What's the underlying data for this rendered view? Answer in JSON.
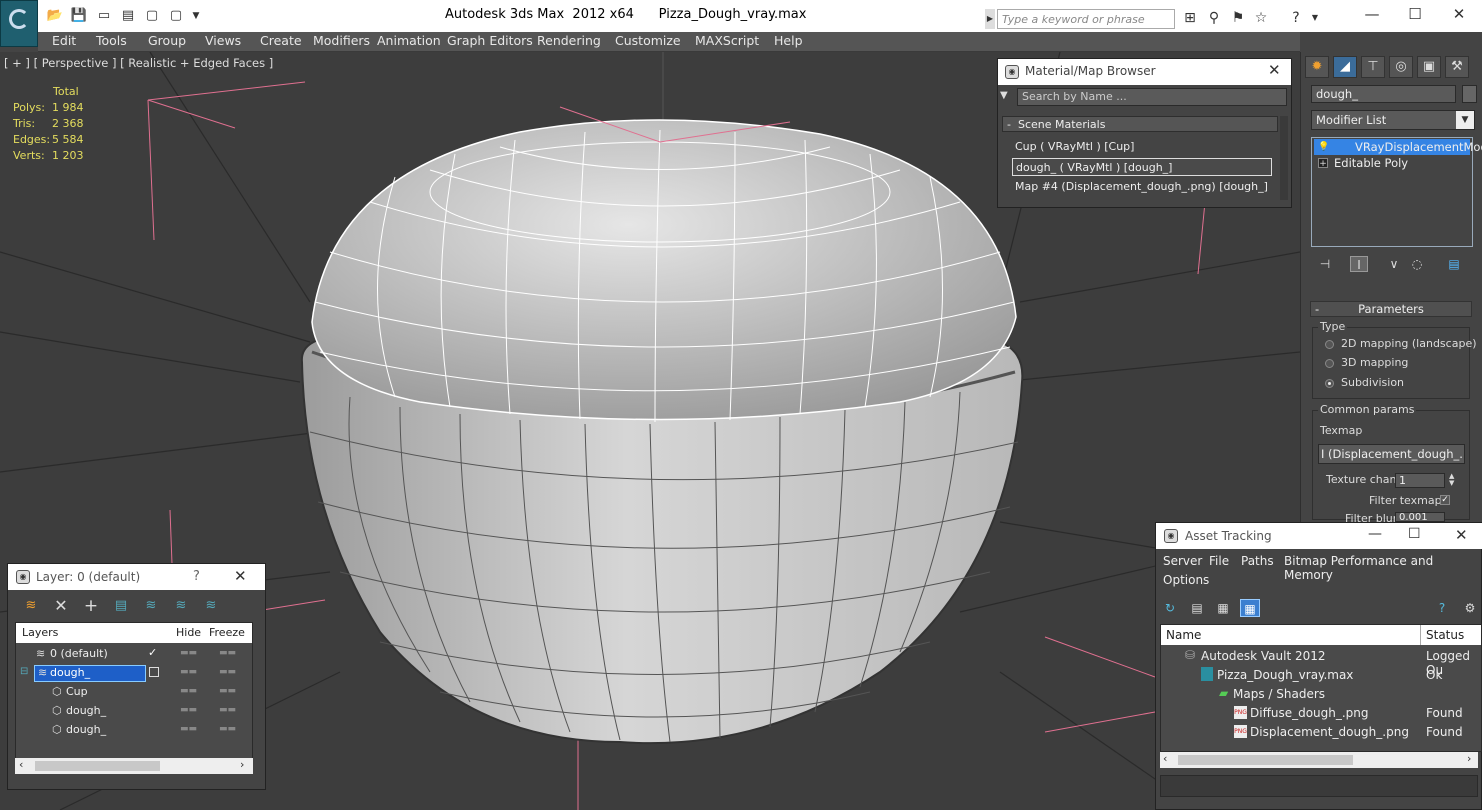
{
  "title_bar": {
    "title": "Autodesk 3ds Max  2012 x64      Pizza_Dough_vray.max",
    "search_placeholder": "Type a keyword or phrase"
  },
  "menu": {
    "items": [
      "Edit",
      "Tools",
      "Group",
      "Views",
      "Create",
      "Modifiers",
      "Animation",
      "Graph Editors",
      "Rendering",
      "Customize",
      "MAXScript",
      "Help"
    ]
  },
  "viewport": {
    "label": "[ + ] [ Perspective ] [ Realistic + Edged Faces ]",
    "stats": {
      "header": "Total",
      "polys_label": "Polys:",
      "polys": "1 984",
      "tris_label": "Tris:",
      "tris": "2 368",
      "edges_label": "Edges:",
      "edges": "5 584",
      "verts_label": "Verts:",
      "verts": "1 203"
    }
  },
  "material_browser": {
    "title": "Material/Map Browser",
    "search_placeholder": "Search by Name ...",
    "section": "Scene Materials",
    "items": [
      "Cup  ( VRayMtl ) [Cup]",
      "dough_  ( VRayMtl ) [dough_]",
      "Map #4 (Displacement_dough_.png) [dough_]"
    ]
  },
  "command_panel": {
    "object_name": "dough_",
    "modifier_list": "Modifier List",
    "stack": [
      "VRayDisplacementMod",
      "Editable Poly"
    ],
    "params_title": "Parameters",
    "type_label": "Type",
    "types": [
      "2D mapping (landscape)",
      "3D mapping",
      "Subdivision"
    ],
    "common_label": "Common params",
    "texmap_label": "Texmap",
    "texmap_value": "I (Displacement_dough_.png)",
    "texture_chan_label": "Texture chan",
    "texture_chan_value": "1",
    "filter_texmap_label": "Filter texmap",
    "filter_blur_label": "Filter blur",
    "filter_blur_value": "0.001"
  },
  "layer_window": {
    "title": "Layer: 0 (default)",
    "help": "?",
    "columns": [
      "Layers",
      "Hide",
      "Freeze"
    ],
    "rows": [
      "0 (default)",
      "dough_",
      "Cup",
      "dough_",
      "dough_"
    ]
  },
  "asset_tracking": {
    "title": "Asset Tracking",
    "menu": [
      "Server",
      "File",
      "Paths",
      "Bitmap Performance and Memory",
      "Options"
    ],
    "columns": [
      "Name",
      "Status"
    ],
    "rows": [
      {
        "name": "Autodesk Vault 2012",
        "status": "Logged Ou"
      },
      {
        "name": "Pizza_Dough_vray.max",
        "status": "Ok"
      },
      {
        "name": "Maps / Shaders",
        "status": ""
      },
      {
        "name": "Diffuse_dough_.png",
        "status": "Found"
      },
      {
        "name": "Displacement_dough_.png",
        "status": "Found"
      }
    ]
  }
}
